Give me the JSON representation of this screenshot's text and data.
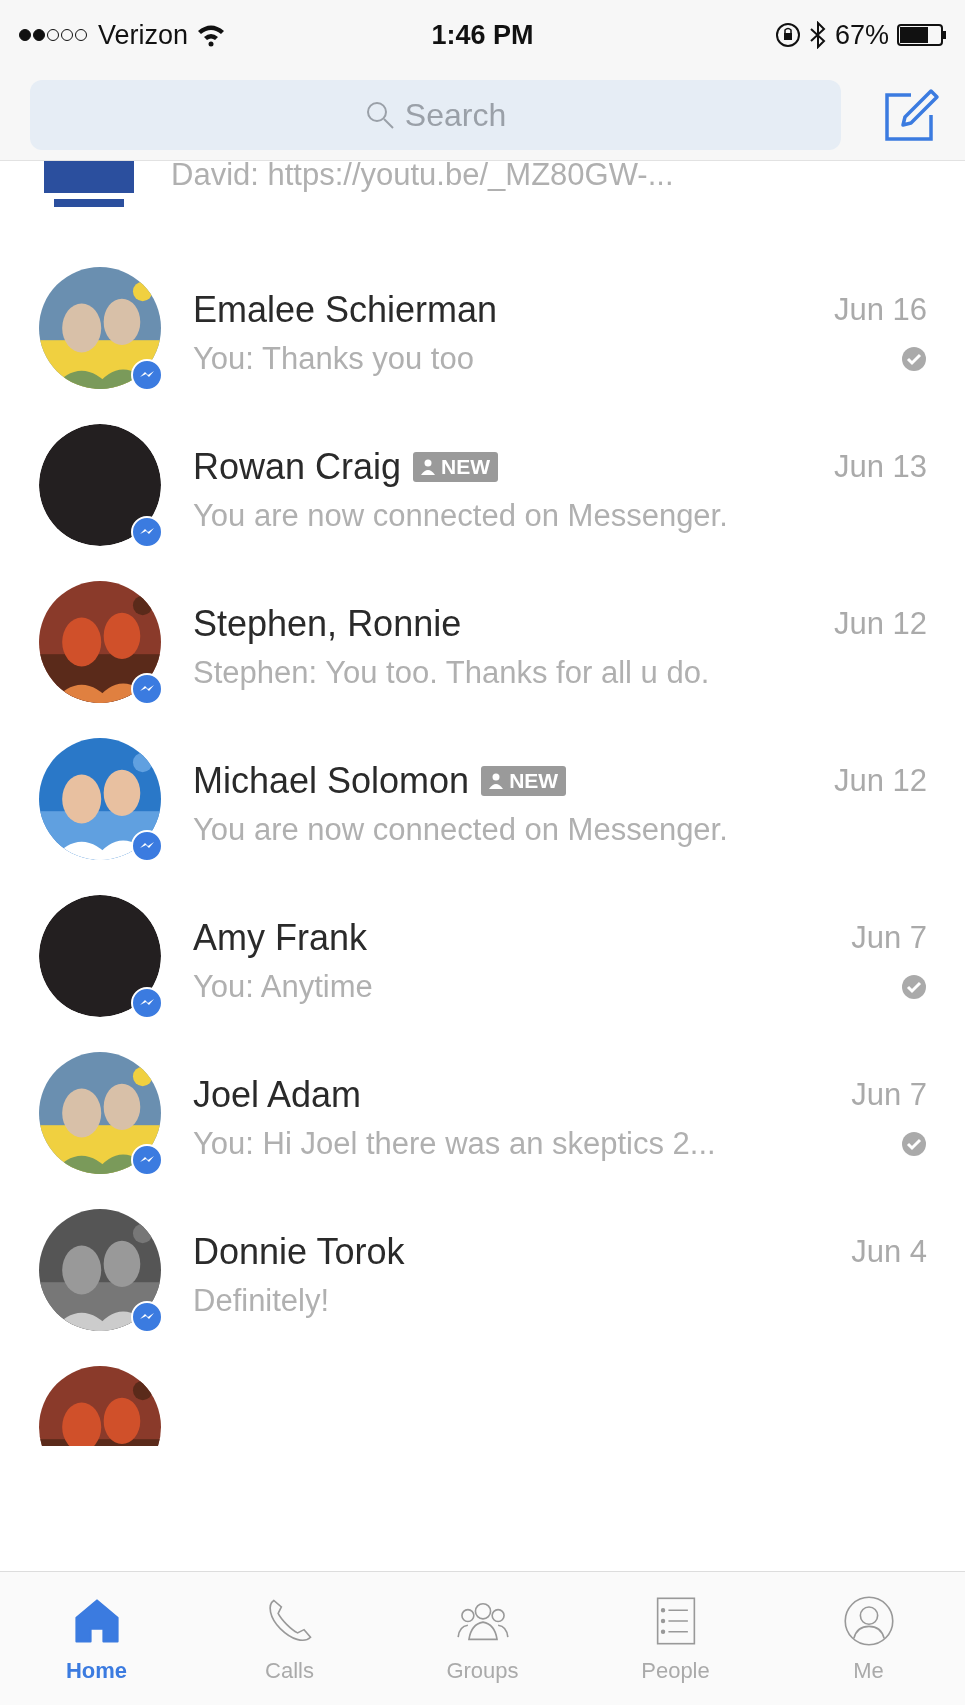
{
  "status_bar": {
    "carrier": "Verizon",
    "time": "1:46 PM",
    "battery": "67%"
  },
  "search": {
    "placeholder": "Search"
  },
  "conversations": [
    {
      "kind": "cut_top",
      "preview": "David: https://youtu.be/_MZ80GW-..."
    },
    {
      "kind": "full",
      "name": "Emalee Schierman",
      "date": "Jun 16",
      "preview": "You: Thanks you too",
      "has_photo": true,
      "new": false,
      "seen": true
    },
    {
      "kind": "full",
      "name": "Rowan Craig",
      "date": "Jun 13",
      "preview": "You are now connected on Messenger.",
      "has_photo": false,
      "new": true,
      "new_label": "NEW",
      "seen": false
    },
    {
      "kind": "full",
      "name": "Stephen, Ronnie",
      "date": "Jun 12",
      "preview": "Stephen: You too. Thanks for all u do.",
      "has_photo": true,
      "new": false,
      "seen": false
    },
    {
      "kind": "full",
      "name": "Michael Solomon",
      "date": "Jun 12",
      "preview": "You are now connected on Messenger.",
      "has_photo": true,
      "new": true,
      "new_label": "NEW",
      "seen": false
    },
    {
      "kind": "full",
      "name": "Amy Frank",
      "date": "Jun 7",
      "preview": "You: Anytime",
      "has_photo": false,
      "new": false,
      "seen": true
    },
    {
      "kind": "full",
      "name": "Joel Adam",
      "date": "Jun 7",
      "preview": "You: Hi Joel there was an skeptics 2...",
      "has_photo": true,
      "new": false,
      "seen": true
    },
    {
      "kind": "full",
      "name": "Donnie Torok",
      "date": "Jun 4",
      "preview": "Definitely!",
      "has_photo": true,
      "new": false,
      "seen": false
    },
    {
      "kind": "cut_bottom"
    }
  ],
  "tabs": [
    {
      "label": "Home",
      "selected": true
    },
    {
      "label": "Calls",
      "selected": false
    },
    {
      "label": "Groups",
      "selected": false
    },
    {
      "label": "People",
      "selected": false
    },
    {
      "label": "Me",
      "selected": false
    }
  ]
}
